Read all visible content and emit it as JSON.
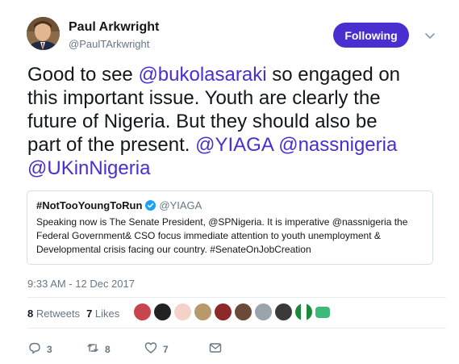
{
  "author": {
    "name": "Paul Arkwright",
    "handle": "@PaulTArkwright"
  },
  "follow_label": "Following",
  "tweet": {
    "line1_a": "Good to see ",
    "mention1": "@bukolasaraki",
    "line1_b": " so engaged on",
    "line2": "this important issue. Youth are clearly the",
    "line3": "future of Nigeria. But they should also be",
    "line4": "part of the present. ",
    "mention2": "@YIAGA",
    "mention3": "@nassnigeria",
    "mention4": "@UKinNigeria"
  },
  "quote": {
    "name": "#NotTooYoungToRun",
    "handle": "@YIAGA",
    "line1": "Speaking now is The Senate President, @SPNigeria. It is imperative @nassnigeria the",
    "line2": "Federal Government& CSO focus immediate attention to youth unemployment &",
    "line3": "Developmental crisis facing our country.  #SenateOnJobCreation"
  },
  "timestamp": "9:33 AM - 12 Dec 2017",
  "stats": {
    "retweets_count": "8",
    "retweets_label": "Retweets",
    "likes_count": "7",
    "likes_label": "Likes"
  },
  "actions": {
    "replies": "3",
    "retweets": "8",
    "likes": "7"
  },
  "icons": [
    "caret-down-icon",
    "verified-icon",
    "reply-icon",
    "retweet-icon",
    "like-icon",
    "message-icon"
  ],
  "colors": {
    "accent": "#4b2ed0",
    "muted": "#657786",
    "verified": "#1da1f2"
  }
}
